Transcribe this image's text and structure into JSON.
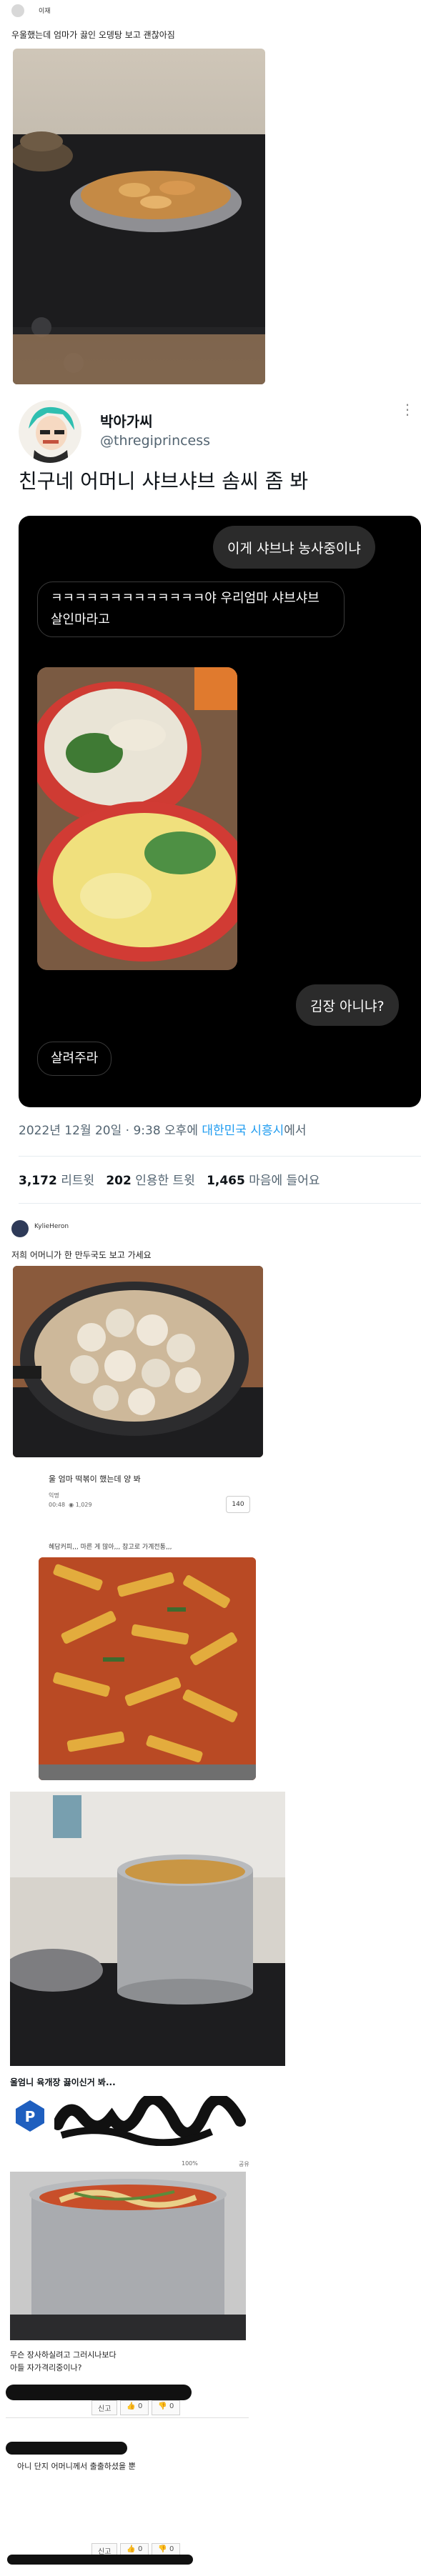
{
  "post1": {
    "username": "이재",
    "caption": "우울했는데 엄마가 끓인 오뎅탕 보고 괜찮아짐"
  },
  "tweet": {
    "display_name": "박아가씨",
    "handle": "@thregiprincess",
    "text": "친구네 어머니 샤브샤브 솜씨 좀 봐",
    "more_icon": "more-dots-icon",
    "dm": {
      "msg_out_1": "이게 샤브냐 농사중이냐",
      "msg_in_1": "ㅋㅋㅋㅋㅋㅋㅋㅋㅋㅋㅋㅋㅋ야 우리엄마 샤브샤브살인마라고",
      "msg_out_2": "김장 아니냐?",
      "msg_in_2": "살려주라"
    },
    "timestamp": "2022년 12월 20일 · 9:38 오후에 ",
    "location": "대한민국 시흥시",
    "location_suffix": "에서",
    "stats": {
      "retweets": "3,172",
      "retweets_label": "리트윗",
      "quotes": "202",
      "quotes_label": "인용한 트윗",
      "likes": "1,465",
      "likes_label": "마음에 들어요"
    }
  },
  "post2": {
    "username": "KylieHeron",
    "caption": "저희 어머니가 한 만두국도 보고 가세요"
  },
  "post3": {
    "title": "울 엄마 떡볶이 했는데 양 봐",
    "meta_author": "익명",
    "meta_time": "00:48",
    "meta_views": "1,029",
    "recommend_count": "140",
    "comment": "혜담커피,,, 마른 게 많아,,, 참고로 가계전통,,,"
  },
  "post4": {
    "title": "울엄니 육개장 끓이신거 봐...",
    "zoom": "100%",
    "share": "공유"
  },
  "post5": {
    "comment1": "무슨 장사하실려고 그러시나보다",
    "comment2": "아들 자가격리중이나?",
    "comment3": "아니 단지 어머니께서 출출하셨을 뿐",
    "report_label": "신고",
    "up_label": "👍 0",
    "down_label": "👎 0"
  }
}
